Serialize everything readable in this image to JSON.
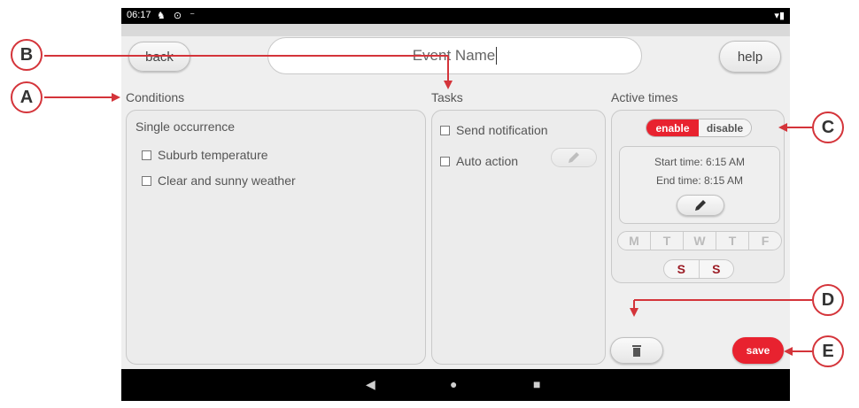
{
  "status": {
    "time": "06:17",
    "icons": "♞ ⊙ ⁻",
    "right": "▾▮"
  },
  "header": {
    "back_label": "back",
    "event_name_value": "Event Name",
    "help_label": "help"
  },
  "conditions": {
    "title": "Conditions",
    "occurrence": "Single occurrence",
    "items": [
      {
        "label": "Suburb temperature"
      },
      {
        "label": "Clear and sunny weather"
      }
    ]
  },
  "tasks": {
    "title": "Tasks",
    "items": [
      {
        "label": "Send notification"
      },
      {
        "label": "Auto action"
      }
    ]
  },
  "active_times": {
    "title": "Active times",
    "enable_label": "enable",
    "disable_label": "disable",
    "start_time": "Start time: 6:15 AM",
    "end_time": "End time: 8:15 AM",
    "weekdays": [
      "M",
      "T",
      "W",
      "T",
      "F"
    ],
    "weekend": [
      "S",
      "S"
    ]
  },
  "save_label": "save",
  "callouts": {
    "a": "A",
    "b": "B",
    "c": "C",
    "d": "D",
    "e": "E"
  },
  "colors": {
    "accent": "#e8222f",
    "callout": "#d4343a",
    "weekend_text": "#9b1b24"
  },
  "icons": {
    "edit": "pencil-icon",
    "delete": "trash-icon"
  }
}
